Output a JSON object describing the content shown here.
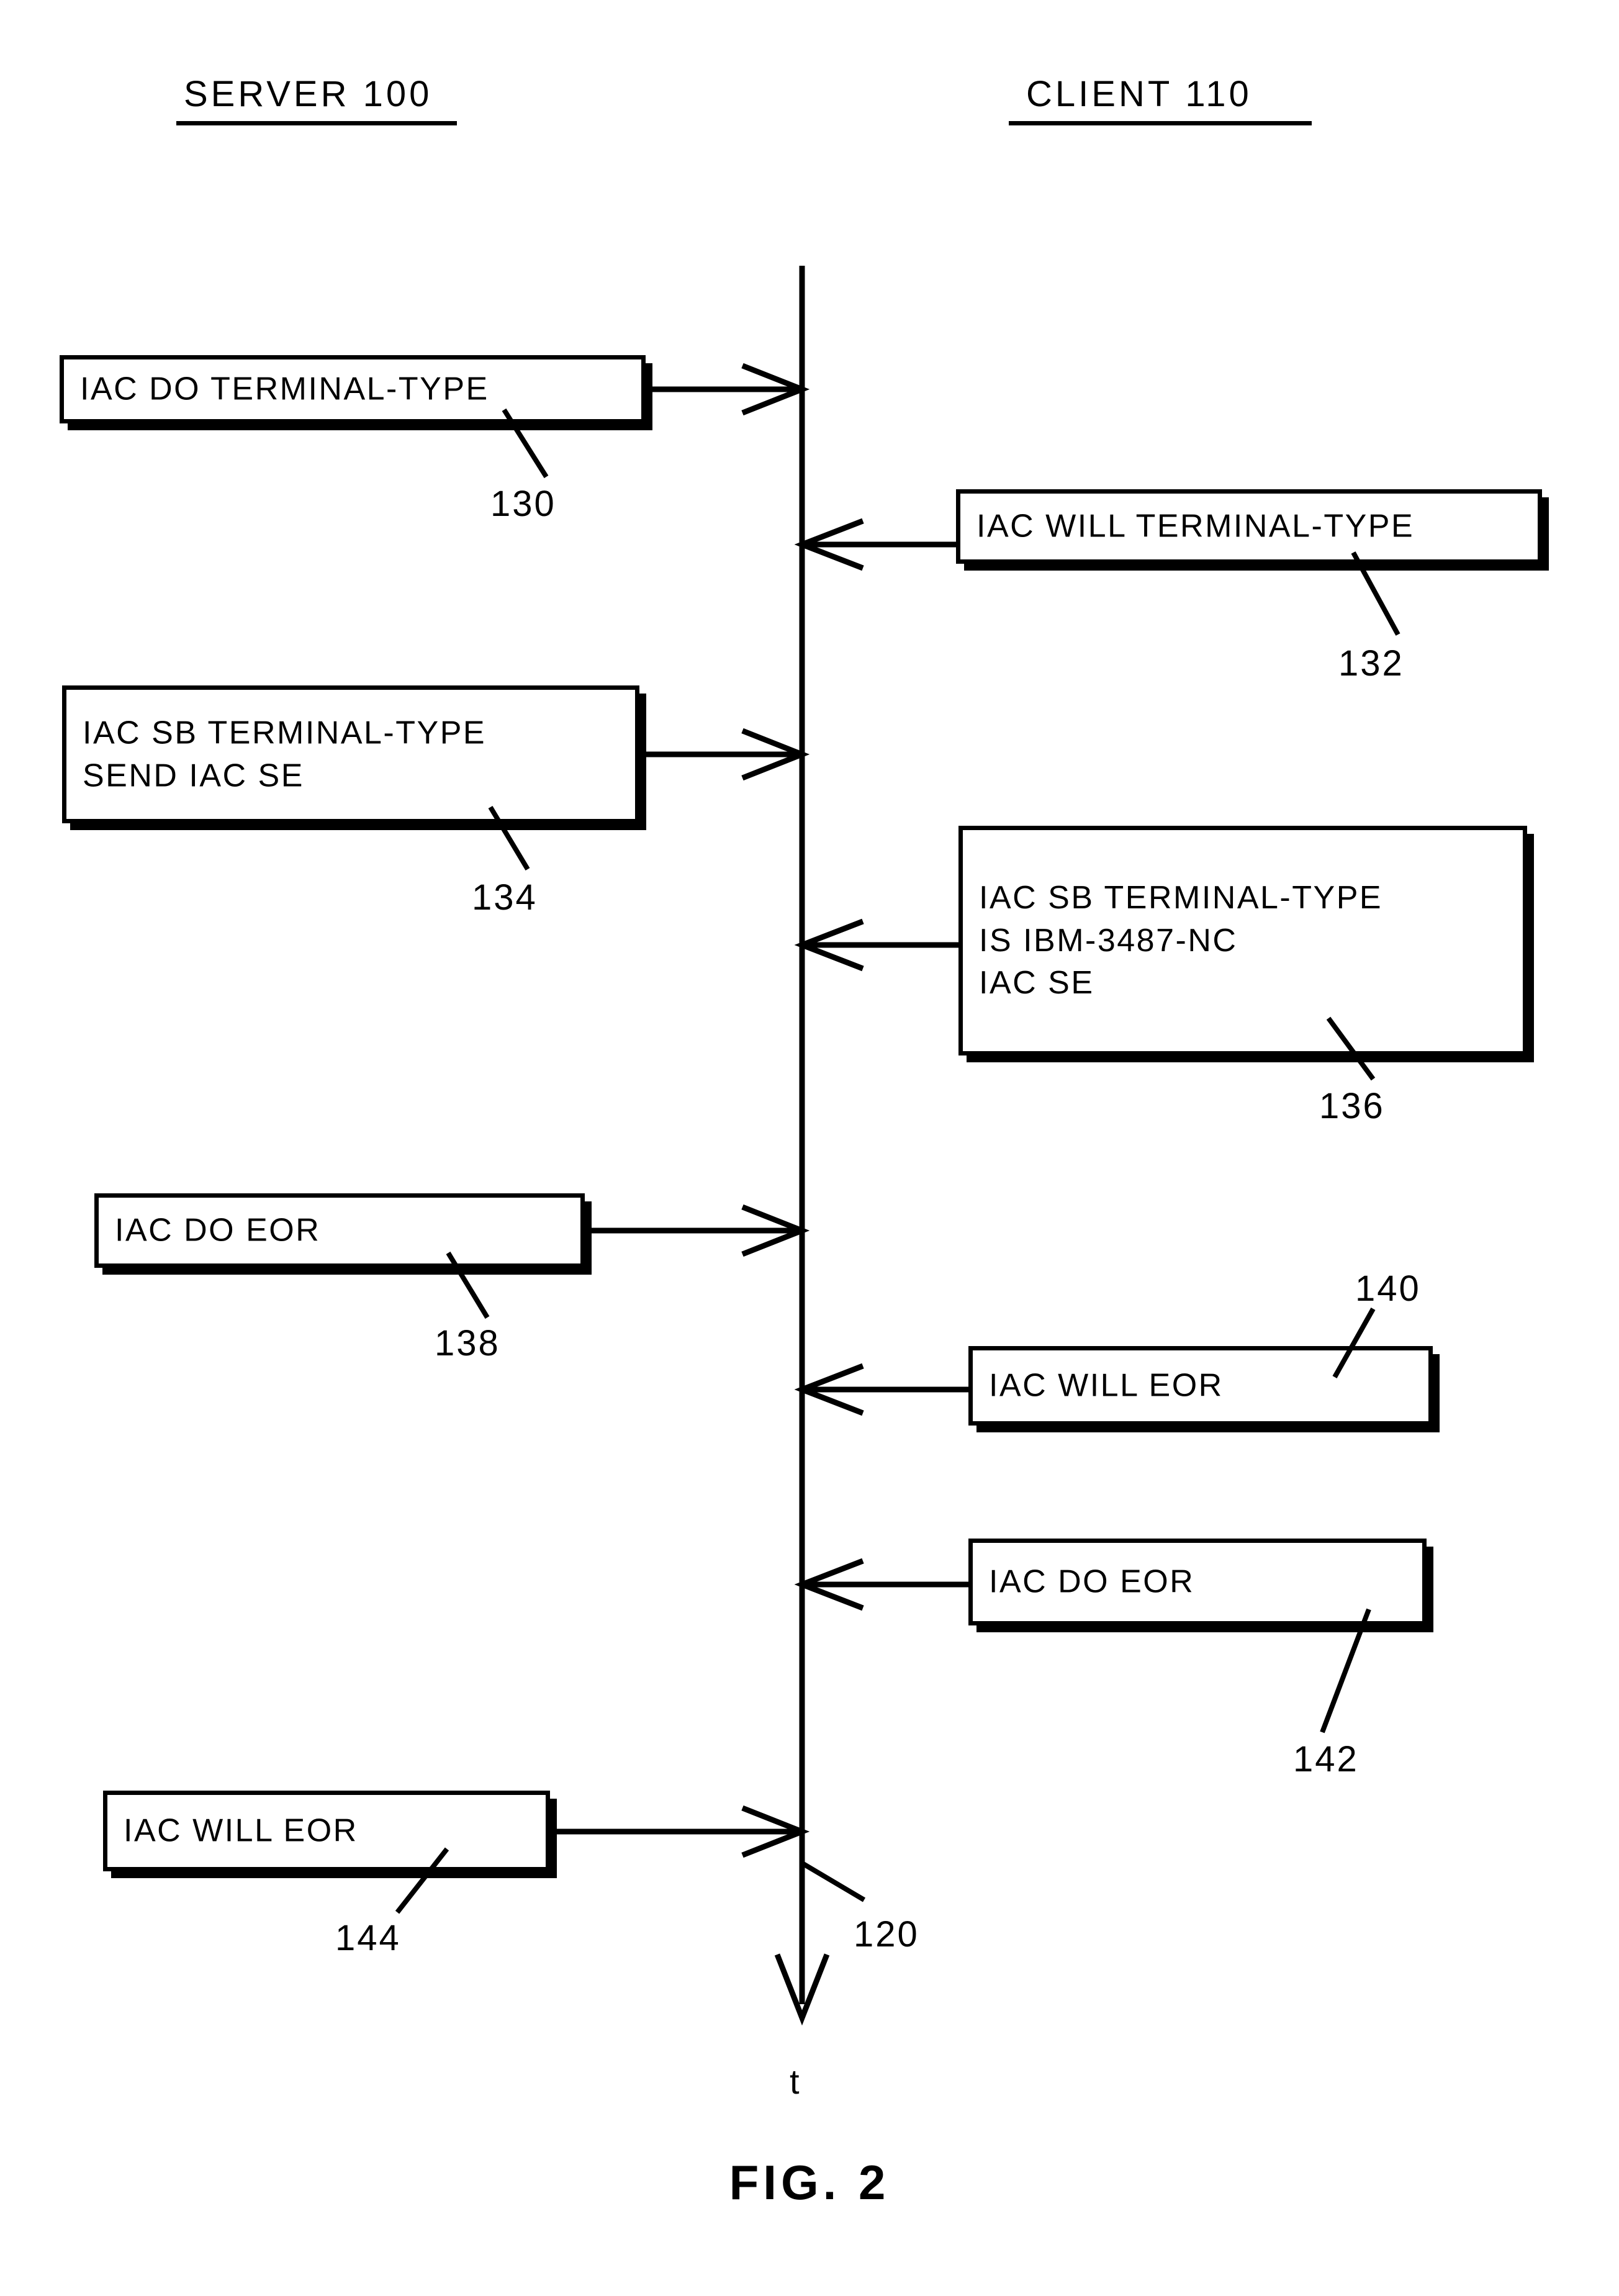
{
  "figure": {
    "caption": "FIG. 2",
    "type": "sequence-diagram"
  },
  "columns": [
    {
      "id": "server",
      "label": "SERVER 100"
    },
    {
      "id": "client",
      "label": "CLIENT 110"
    }
  ],
  "timeline": {
    "ref": "120",
    "axis_label": "t",
    "direction": "downward"
  },
  "messages": [
    {
      "ref": "130",
      "origin": "server",
      "direction": "server-to-client",
      "text": "IAC DO TERMINAL-TYPE"
    },
    {
      "ref": "132",
      "origin": "client",
      "direction": "client-to-server",
      "text": "IAC WILL TERMINAL-TYPE"
    },
    {
      "ref": "134",
      "origin": "server",
      "direction": "server-to-client",
      "text": "IAC SB TERMINAL-TYPE\nSEND IAC SE"
    },
    {
      "ref": "136",
      "origin": "client",
      "direction": "client-to-server",
      "text": "IAC SB TERMINAL-TYPE\nIS IBM-3487-NC\nIAC SE"
    },
    {
      "ref": "138",
      "origin": "server",
      "direction": "server-to-client",
      "text": "IAC DO EOR"
    },
    {
      "ref": "140",
      "origin": "client",
      "direction": "client-to-server",
      "text": "IAC WILL EOR"
    },
    {
      "ref": "142",
      "origin": "client",
      "direction": "client-to-server",
      "text": "IAC DO EOR"
    },
    {
      "ref": "144",
      "origin": "server",
      "direction": "server-to-client",
      "text": "IAC WILL EOR"
    }
  ],
  "colors": {
    "ink": "#000000",
    "paper": "#ffffff"
  }
}
